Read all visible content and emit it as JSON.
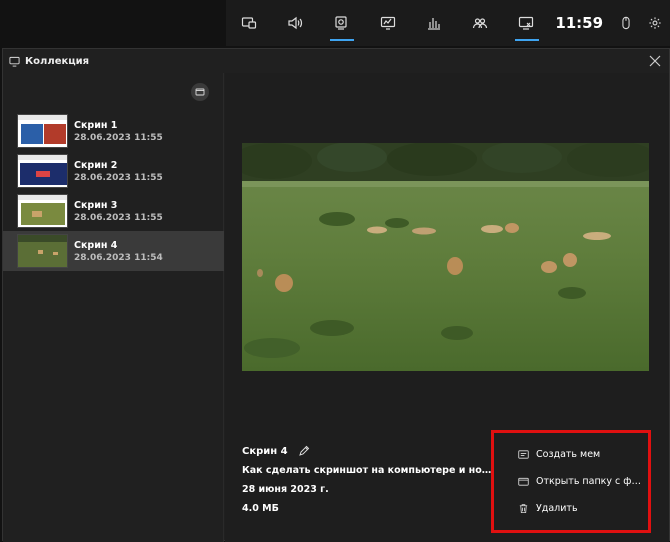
{
  "topbar": {
    "buttons": [
      {
        "icon": "widget-menu-icon"
      },
      {
        "icon": "audio-icon"
      },
      {
        "icon": "capture-icon",
        "active": true
      },
      {
        "icon": "performance-icon"
      },
      {
        "icon": "resources-icon"
      },
      {
        "icon": "social-icon"
      },
      {
        "icon": "gallery-icon",
        "active": true
      }
    ],
    "clock": "11:59"
  },
  "window": {
    "title": "Коллекция"
  },
  "screenshots": [
    {
      "name": "Скрин 1",
      "date": "28.06.2023 11:55"
    },
    {
      "name": "Скрин 2",
      "date": "28.06.2023 11:55"
    },
    {
      "name": "Скрин 3",
      "date": "28.06.2023 11:55"
    },
    {
      "name": "Скрин 4",
      "date": "28.06.2023 11:54",
      "selected": true
    }
  ],
  "details": {
    "name": "Скрин 4",
    "title": "Как сделать скриншот на компьютере и ноутбуке - ...",
    "date": "28 июня 2023 г.",
    "size": "4.0 МБ"
  },
  "actions": {
    "create_meme": "Создать мем",
    "open_folder": "Открыть папку с фа...",
    "delete": "Удалить"
  },
  "colors": {
    "accent": "#3fa4f0",
    "highlight_box": "#e01010"
  }
}
